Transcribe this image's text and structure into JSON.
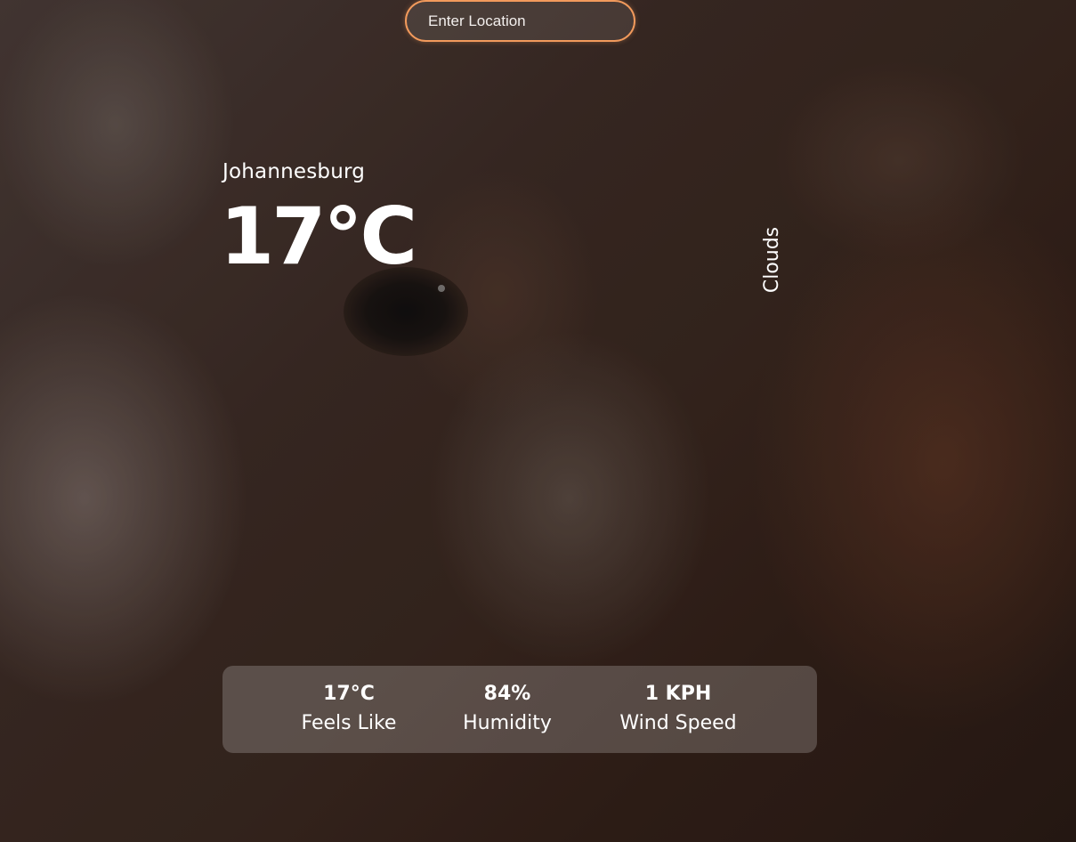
{
  "search": {
    "placeholder": "Enter Location",
    "value": ""
  },
  "weather": {
    "location": "Johannesburg",
    "temperature": "17°C",
    "condition": "Clouds"
  },
  "details": {
    "feels_like": {
      "value": "17°C",
      "label": "Feels Like"
    },
    "humidity": {
      "value": "84%",
      "label": "Humidity"
    },
    "wind_speed": {
      "value": "1 KPH",
      "label": "Wind Speed"
    }
  },
  "colors": {
    "accent": "#f29a5c",
    "text": "#ffffff"
  }
}
